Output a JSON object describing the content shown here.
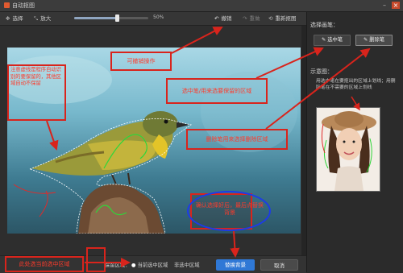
{
  "window": {
    "title": "自动抠图"
  },
  "toolbar": {
    "select_label": "选择",
    "zoom_in_label": "放大",
    "zoom_percent": "50%",
    "zoom_fraction": 0.58,
    "undo_label": "撤销",
    "redo_label": "重做",
    "reset_label": "重新抠图"
  },
  "right_panel": {
    "select_brush_title": "选择画笔：",
    "keep_brush_label": "选中笔",
    "delete_brush_label": "删除笔",
    "example_title": "示意图：",
    "example_desc": "用选中笔在要抠出的区域上划线；用删除笔在不需要的区域上划线"
  },
  "bottom": {
    "keep_area_label": "保留区域：",
    "current_area_option": "当前选中区域",
    "non_selected_option": "非选中区域",
    "confirm_button": "替换背景",
    "cancel_button": "取消"
  },
  "annotations": {
    "undo_note": "可撤销操作",
    "dotted_note": "注意虚线是程序自动识别的要保留的，其他区域自动不保留",
    "keep_brush_note": "选中笔/用来选要保留的区域",
    "delete_brush_note": "删除笔用来选择删除区域",
    "confirm_note": "确认选择好后，最后点替换背景",
    "bottom_note": "此处选当前选中区域"
  },
  "colors": {
    "accent_blue": "#2f78d6",
    "annotation_red": "#d9241c",
    "annotation_blue": "#1d3be8"
  }
}
